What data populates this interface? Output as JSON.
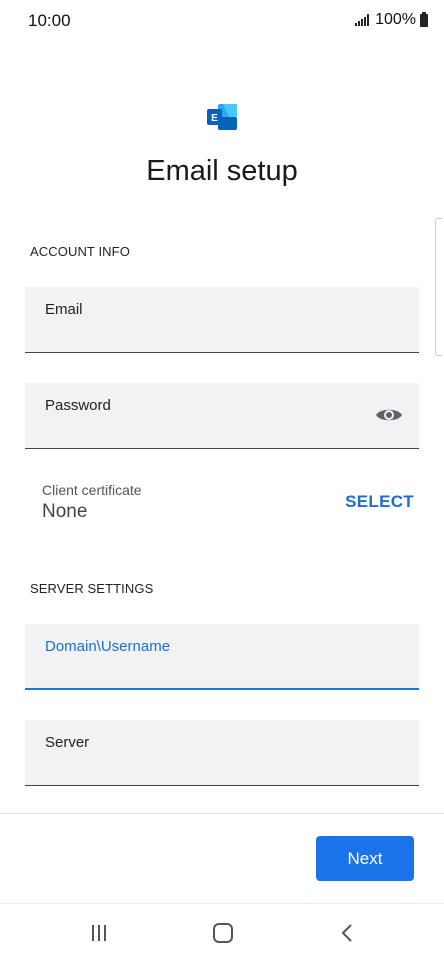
{
  "status_bar": {
    "time": "10:00",
    "battery": "100%"
  },
  "app": {
    "logo_icon": "exchange-logo-icon",
    "title": "Email setup"
  },
  "account_info": {
    "section_label": "ACCOUNT INFO",
    "email": {
      "label": "Email",
      "value": ""
    },
    "password": {
      "label": "Password",
      "value": "",
      "toggle_icon": "eye-icon"
    },
    "client_certificate": {
      "label": "Client certificate",
      "value": "None",
      "action": "SELECT"
    }
  },
  "server_settings": {
    "section_label": "SERVER SETTINGS",
    "domain_username": {
      "label": "Domain\\Username",
      "value": ""
    },
    "server": {
      "label": "Server",
      "value": ""
    }
  },
  "footer": {
    "next_label": "Next"
  },
  "nav": {
    "recent_icon": "recent-apps-icon",
    "home_icon": "home-icon",
    "back_icon": "back-icon"
  },
  "colors": {
    "accent": "#1a73e8",
    "field_bg": "#f1f2f4"
  }
}
